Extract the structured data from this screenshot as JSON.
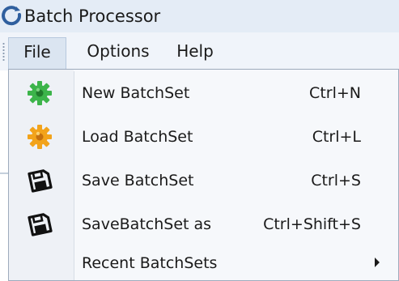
{
  "window": {
    "title": "Batch Processor",
    "icon": "batch-processor-icon"
  },
  "menubar": {
    "items": [
      {
        "label": "File",
        "active": true
      },
      {
        "label": "Options",
        "active": false
      },
      {
        "label": "Help",
        "active": false
      }
    ]
  },
  "file_menu": {
    "items": [
      {
        "label": "New BatchSet",
        "shortcut": "Ctrl+N",
        "icon": "gear-green-icon",
        "icon_color": "#3cb44a"
      },
      {
        "label": "Load BatchSet",
        "shortcut": "Ctrl+L",
        "icon": "gear-orange-icon",
        "icon_color": "#f2a31b"
      },
      {
        "label": "Save BatchSet",
        "shortcut": "Ctrl+S",
        "icon": "floppy-disk-icon"
      },
      {
        "label": "SaveBatchSet as",
        "shortcut": "Ctrl+Shift+S",
        "icon": "floppy-disk-icon"
      },
      {
        "label": "Recent BatchSets",
        "shortcut": "",
        "has_submenu": true
      }
    ]
  },
  "colors": {
    "titlebar_bg": "#e4ecf6",
    "menubar_bg": "#f0f4fa",
    "dropdown_bg": "#f6f8fb",
    "accent_green": "#3cb44a",
    "accent_orange": "#f2a31b"
  }
}
